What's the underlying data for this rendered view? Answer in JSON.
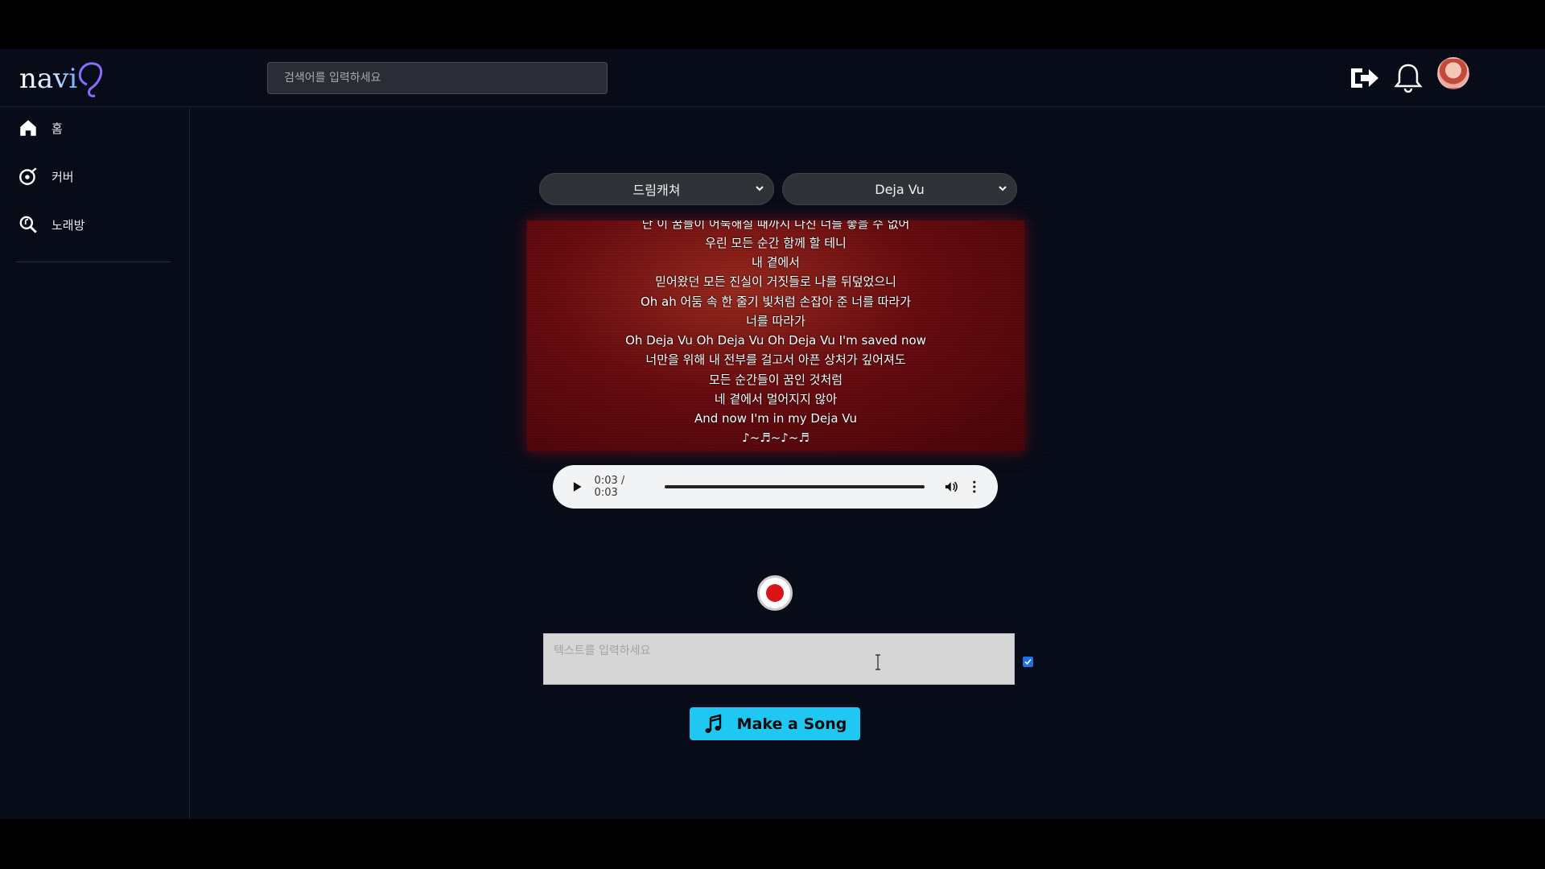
{
  "header": {
    "logo_text": "navi",
    "search_placeholder": "검색어를 입력하세요",
    "icons": [
      "logout-icon",
      "bell-icon",
      "avatar"
    ]
  },
  "sidebar": {
    "items": [
      {
        "label": "홈",
        "icon": "home-icon"
      },
      {
        "label": "커버",
        "icon": "cover-icon"
      },
      {
        "label": "노래방",
        "icon": "search-music-icon"
      }
    ]
  },
  "selectors": {
    "artist": "드림캐쳐",
    "song": "Deja Vu"
  },
  "lyrics": [
    "난 이 꿈들이 어둑해질 때까지 나진 너를 좋을 수 없어",
    "우린 모든 순간 함께 할 테니",
    "내 곁에서",
    "믿어왔던 모든 진실이 거짓들로 나를 뒤덮었으니",
    "Oh ah 어둠 속 한 줄기 빛처럼 손잡아 준 너를 따라가",
    "너를 따라가",
    "Oh Deja Vu Oh Deja Vu Oh Deja Vu I'm saved now",
    "너만을 위해 내 전부를 걸고서 아픈 상처가 깊어져도",
    "모든 순간들이 꿈인 것처럼",
    "네 곁에서 멀어지지 않아",
    "And now I'm in my Deja Vu",
    "♪~♬~♪~♬"
  ],
  "audio": {
    "time": "0:03 / 0:03",
    "progress": 1.0
  },
  "input": {
    "placeholder": "텍스트를 입력하세요",
    "checked": true
  },
  "action": {
    "label": "Make a Song"
  },
  "colors": {
    "accent": "#1ec8f2",
    "record": "#d81414",
    "lyrics_bg": "#6a0c10"
  }
}
